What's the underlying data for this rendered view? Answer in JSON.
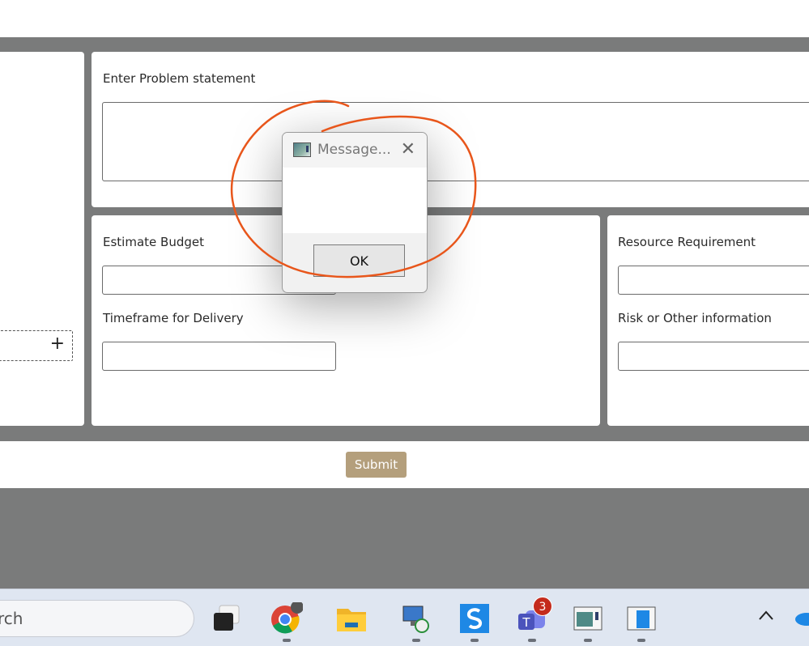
{
  "form": {
    "problem_label": "Enter Problem statement",
    "budget_label": "Estimate Budget",
    "timeframe_label": "Timeframe for Delivery",
    "resource_label": "Resource Requirement",
    "risk_label": "Risk or Other information",
    "add_symbol": "+",
    "submit_label": "Submit"
  },
  "dialog": {
    "title": "Message...",
    "close_symbol": "✕",
    "message": "",
    "ok_label": "OK"
  },
  "taskbar": {
    "search_text": "rch",
    "teams_badge": "3",
    "tray_chevron": "^"
  },
  "colors": {
    "submit": "#b49f7c",
    "annotation_stroke": "#e8561b",
    "page_background": "#7a7b7b"
  }
}
